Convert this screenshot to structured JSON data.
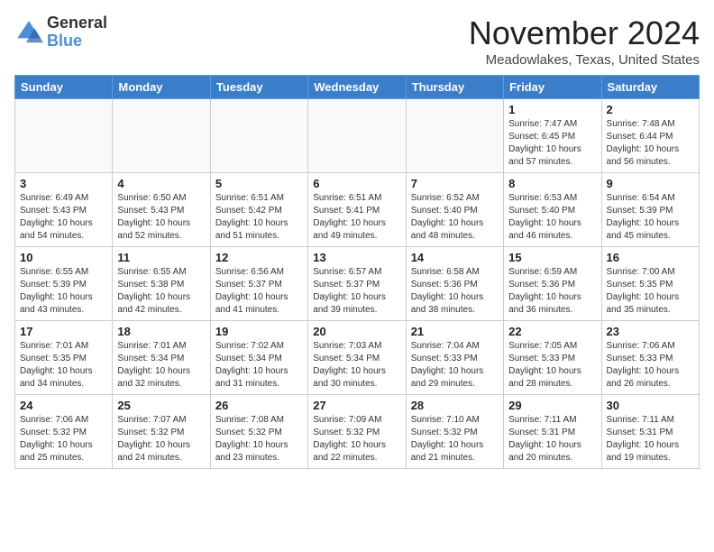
{
  "logo": {
    "general": "General",
    "blue": "Blue"
  },
  "header": {
    "month": "November 2024",
    "location": "Meadowlakes, Texas, United States"
  },
  "weekdays": [
    "Sunday",
    "Monday",
    "Tuesday",
    "Wednesday",
    "Thursday",
    "Friday",
    "Saturday"
  ],
  "weeks": [
    [
      {
        "day": "",
        "info": ""
      },
      {
        "day": "",
        "info": ""
      },
      {
        "day": "",
        "info": ""
      },
      {
        "day": "",
        "info": ""
      },
      {
        "day": "",
        "info": ""
      },
      {
        "day": "1",
        "info": "Sunrise: 7:47 AM\nSunset: 6:45 PM\nDaylight: 10 hours and 57 minutes."
      },
      {
        "day": "2",
        "info": "Sunrise: 7:48 AM\nSunset: 6:44 PM\nDaylight: 10 hours and 56 minutes."
      }
    ],
    [
      {
        "day": "3",
        "info": "Sunrise: 6:49 AM\nSunset: 5:43 PM\nDaylight: 10 hours and 54 minutes."
      },
      {
        "day": "4",
        "info": "Sunrise: 6:50 AM\nSunset: 5:43 PM\nDaylight: 10 hours and 52 minutes."
      },
      {
        "day": "5",
        "info": "Sunrise: 6:51 AM\nSunset: 5:42 PM\nDaylight: 10 hours and 51 minutes."
      },
      {
        "day": "6",
        "info": "Sunrise: 6:51 AM\nSunset: 5:41 PM\nDaylight: 10 hours and 49 minutes."
      },
      {
        "day": "7",
        "info": "Sunrise: 6:52 AM\nSunset: 5:40 PM\nDaylight: 10 hours and 48 minutes."
      },
      {
        "day": "8",
        "info": "Sunrise: 6:53 AM\nSunset: 5:40 PM\nDaylight: 10 hours and 46 minutes."
      },
      {
        "day": "9",
        "info": "Sunrise: 6:54 AM\nSunset: 5:39 PM\nDaylight: 10 hours and 45 minutes."
      }
    ],
    [
      {
        "day": "10",
        "info": "Sunrise: 6:55 AM\nSunset: 5:39 PM\nDaylight: 10 hours and 43 minutes."
      },
      {
        "day": "11",
        "info": "Sunrise: 6:55 AM\nSunset: 5:38 PM\nDaylight: 10 hours and 42 minutes."
      },
      {
        "day": "12",
        "info": "Sunrise: 6:56 AM\nSunset: 5:37 PM\nDaylight: 10 hours and 41 minutes."
      },
      {
        "day": "13",
        "info": "Sunrise: 6:57 AM\nSunset: 5:37 PM\nDaylight: 10 hours and 39 minutes."
      },
      {
        "day": "14",
        "info": "Sunrise: 6:58 AM\nSunset: 5:36 PM\nDaylight: 10 hours and 38 minutes."
      },
      {
        "day": "15",
        "info": "Sunrise: 6:59 AM\nSunset: 5:36 PM\nDaylight: 10 hours and 36 minutes."
      },
      {
        "day": "16",
        "info": "Sunrise: 7:00 AM\nSunset: 5:35 PM\nDaylight: 10 hours and 35 minutes."
      }
    ],
    [
      {
        "day": "17",
        "info": "Sunrise: 7:01 AM\nSunset: 5:35 PM\nDaylight: 10 hours and 34 minutes."
      },
      {
        "day": "18",
        "info": "Sunrise: 7:01 AM\nSunset: 5:34 PM\nDaylight: 10 hours and 32 minutes."
      },
      {
        "day": "19",
        "info": "Sunrise: 7:02 AM\nSunset: 5:34 PM\nDaylight: 10 hours and 31 minutes."
      },
      {
        "day": "20",
        "info": "Sunrise: 7:03 AM\nSunset: 5:34 PM\nDaylight: 10 hours and 30 minutes."
      },
      {
        "day": "21",
        "info": "Sunrise: 7:04 AM\nSunset: 5:33 PM\nDaylight: 10 hours and 29 minutes."
      },
      {
        "day": "22",
        "info": "Sunrise: 7:05 AM\nSunset: 5:33 PM\nDaylight: 10 hours and 28 minutes."
      },
      {
        "day": "23",
        "info": "Sunrise: 7:06 AM\nSunset: 5:33 PM\nDaylight: 10 hours and 26 minutes."
      }
    ],
    [
      {
        "day": "24",
        "info": "Sunrise: 7:06 AM\nSunset: 5:32 PM\nDaylight: 10 hours and 25 minutes."
      },
      {
        "day": "25",
        "info": "Sunrise: 7:07 AM\nSunset: 5:32 PM\nDaylight: 10 hours and 24 minutes."
      },
      {
        "day": "26",
        "info": "Sunrise: 7:08 AM\nSunset: 5:32 PM\nDaylight: 10 hours and 23 minutes."
      },
      {
        "day": "27",
        "info": "Sunrise: 7:09 AM\nSunset: 5:32 PM\nDaylight: 10 hours and 22 minutes."
      },
      {
        "day": "28",
        "info": "Sunrise: 7:10 AM\nSunset: 5:32 PM\nDaylight: 10 hours and 21 minutes."
      },
      {
        "day": "29",
        "info": "Sunrise: 7:11 AM\nSunset: 5:31 PM\nDaylight: 10 hours and 20 minutes."
      },
      {
        "day": "30",
        "info": "Sunrise: 7:11 AM\nSunset: 5:31 PM\nDaylight: 10 hours and 19 minutes."
      }
    ]
  ]
}
